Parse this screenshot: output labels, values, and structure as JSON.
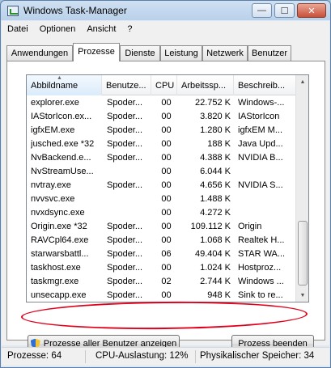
{
  "window": {
    "title": "Windows Task-Manager"
  },
  "title_buttons": {
    "minimize": "—",
    "maximize": "☐",
    "close": "✕"
  },
  "menu": [
    "Datei",
    "Optionen",
    "Ansicht",
    "?"
  ],
  "tabs": [
    "Anwendungen",
    "Prozesse",
    "Dienste",
    "Leistung",
    "Netzwerk",
    "Benutzer"
  ],
  "active_tab": "Prozesse",
  "columns": [
    "Abbildname",
    "Benutze...",
    "CPU",
    "Arbeitssp...",
    "Beschreib..."
  ],
  "sorted_column": "Abbildname",
  "rows": [
    [
      "explorer.exe",
      "Spoder...",
      "00",
      "22.752 K",
      "Windows-..."
    ],
    [
      "IAStorIcon.ex...",
      "Spoder...",
      "00",
      "3.820 K",
      "IAStorIcon"
    ],
    [
      "igfxEM.exe",
      "Spoder...",
      "00",
      "1.280 K",
      "igfxEM M..."
    ],
    [
      "jusched.exe *32",
      "Spoder...",
      "00",
      "188 K",
      "Java Upd..."
    ],
    [
      "NvBackend.e...",
      "Spoder...",
      "00",
      "4.388 K",
      "NVIDIA B..."
    ],
    [
      "NvStreamUse...",
      "",
      "00",
      "6.044 K",
      ""
    ],
    [
      "nvtray.exe",
      "Spoder...",
      "00",
      "4.656 K",
      "NVIDIA S..."
    ],
    [
      "nvvsvc.exe",
      "",
      "00",
      "1.488 K",
      ""
    ],
    [
      "nvxdsync.exe",
      "",
      "00",
      "4.272 K",
      ""
    ],
    [
      "Origin.exe *32",
      "Spoder...",
      "00",
      "109.112 K",
      "Origin"
    ],
    [
      "RAVCpl64.exe",
      "Spoder...",
      "00",
      "1.068 K",
      "Realtek H..."
    ],
    [
      "starwarsbattl...",
      "Spoder...",
      "06",
      "49.404 K",
      "STAR WA..."
    ],
    [
      "taskhost.exe",
      "Spoder...",
      "00",
      "1.024 K",
      "Hostproz..."
    ],
    [
      "taskmgr.exe",
      "Spoder...",
      "02",
      "2.744 K",
      "Windows ..."
    ],
    [
      "unsecapp.exe",
      "Spoder...",
      "00",
      "948 K",
      "Sink to re..."
    ]
  ],
  "buttons": {
    "all_users": "Prozesse aller Benutzer anzeigen",
    "end_process": "Prozess beenden"
  },
  "status": {
    "processes": "Prozesse: 64",
    "cpu": "CPU-Auslastung: 12%",
    "memory": "Physikalischer Speicher: 34"
  },
  "annotation_color": "#e0001b"
}
